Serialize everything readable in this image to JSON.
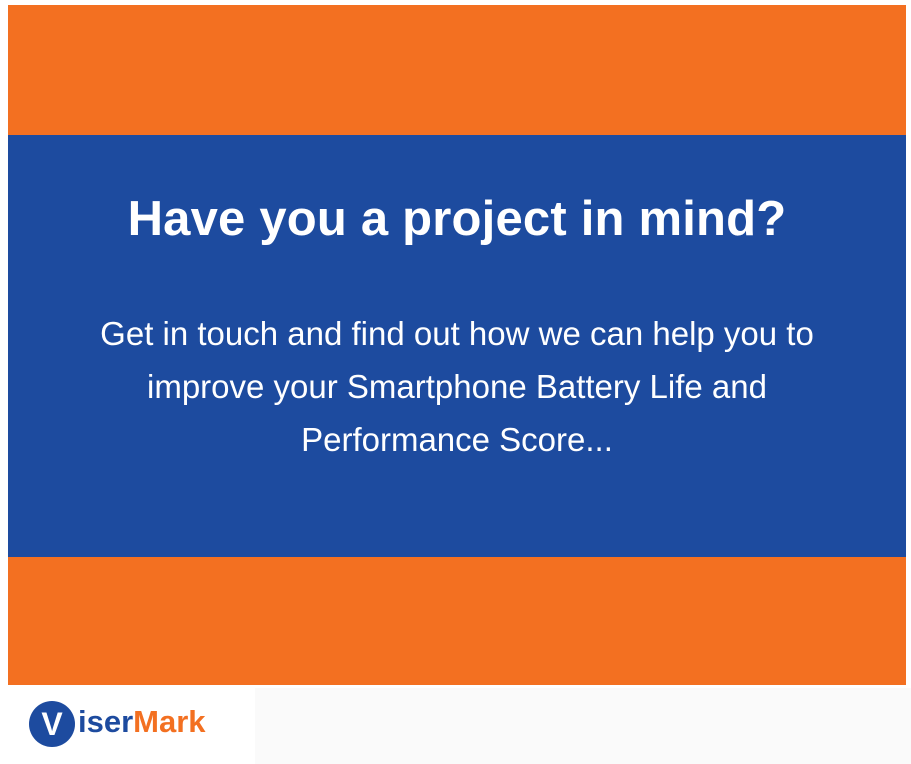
{
  "banner": {
    "headline": "Have you a project in mind?",
    "subtext_line1": "Get in touch and find out how we can help you to",
    "subtext_line2": "improve your Smartphone Battery Life and",
    "subtext_line3": "Performance Score..."
  },
  "logo": {
    "initial": "V",
    "part1": "iser",
    "part2": "Mark"
  },
  "colors": {
    "orange": "#f37021",
    "blue": "#1d4b9f",
    "logo_blue": "#1d4b9f",
    "logo_orange": "#f37021"
  }
}
